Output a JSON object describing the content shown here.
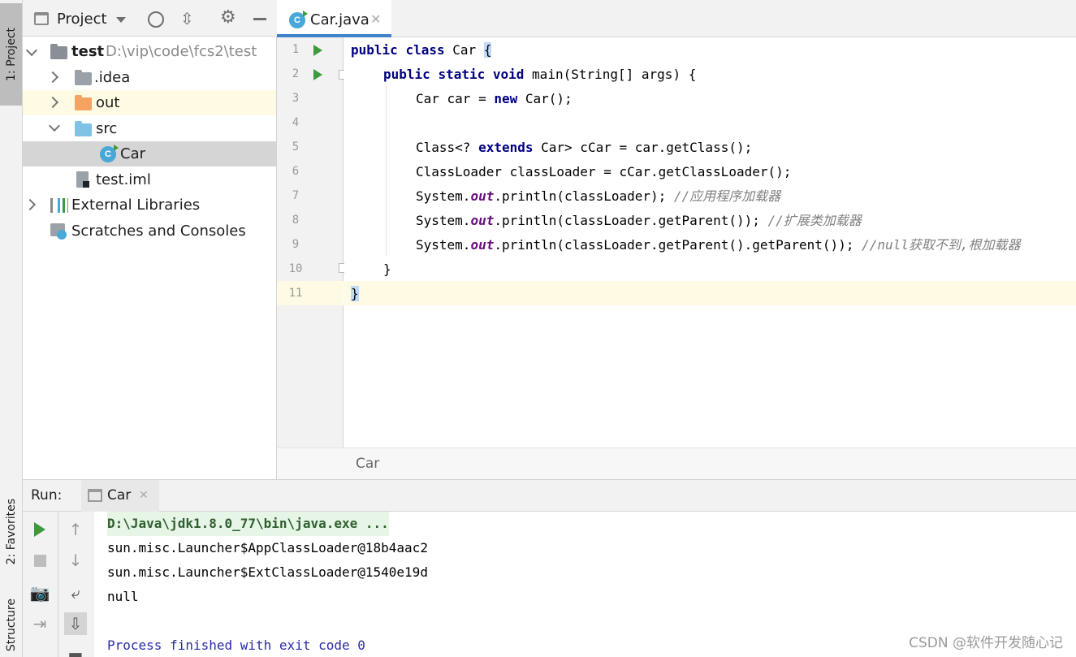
{
  "left_strip": {
    "project_tab": "1: Project",
    "favorites_tab": "2: Favorites",
    "structure_tab": "Structure"
  },
  "project_panel": {
    "title": "Project",
    "tree": [
      {
        "label": "test",
        "path": "D:\\vip\\code\\fcs2\\test"
      },
      {
        "label": ".idea"
      },
      {
        "label": "out"
      },
      {
        "label": "src"
      },
      {
        "label": "Car"
      },
      {
        "label": "test.iml"
      },
      {
        "label": "External Libraries"
      },
      {
        "label": "Scratches and Consoles"
      }
    ]
  },
  "editor": {
    "tab_label": "Car.java",
    "line_numbers": [
      "1",
      "2",
      "3",
      "4",
      "5",
      "6",
      "7",
      "8",
      "9",
      "10",
      "11"
    ],
    "breadcrumb": "Car",
    "lines": {
      "l1": {
        "kw1": "public",
        "kw2": "class",
        "name": "Car",
        "brace": "{"
      },
      "l2": {
        "kw1": "public",
        "kw2": "static",
        "kw3": "void",
        "rest": "main(String[] args) {"
      },
      "l3": {
        "a": "Car car = ",
        "kw": "new",
        "b": "Car();"
      },
      "l5": {
        "a": "Class<? ",
        "kw": "extends",
        "b": "Car> cCar = car.getClass();"
      },
      "l6": {
        "a": "ClassLoader classLoader = cCar.getClassLoader();"
      },
      "l7": {
        "a": "System.",
        "out": "out",
        "b": ".println(classLoader); ",
        "comment": "//应用程序加载器"
      },
      "l8": {
        "a": "System.",
        "out": "out",
        "b": ".println(classLoader.getParent()); ",
        "comment": "//扩展类加载器"
      },
      "l9": {
        "a": "System.",
        "out": "out",
        "b": ".println(classLoader.getParent().getParent()); ",
        "comment": "//null获取不到,根加载器"
      },
      "l10": {
        "a": "}"
      },
      "l11": {
        "brace": "}"
      }
    }
  },
  "run_panel": {
    "label": "Run:",
    "tab": "Car",
    "output": [
      "D:\\Java\\jdk1.8.0_77\\bin\\java.exe ...",
      "sun.misc.Launcher$AppClassLoader@18b4aac2",
      "sun.misc.Launcher$ExtClassLoader@1540e19d",
      "null",
      "",
      "Process finished with exit code 0"
    ]
  },
  "watermark": "CSDN @软件开发随心记",
  "colors": {
    "keyword": "#000080",
    "static_field": "#660e7a",
    "comment": "#808080",
    "run_green": "#3d9a3d",
    "caret_line": "#fffae3",
    "selection": "#d5d5d5"
  }
}
